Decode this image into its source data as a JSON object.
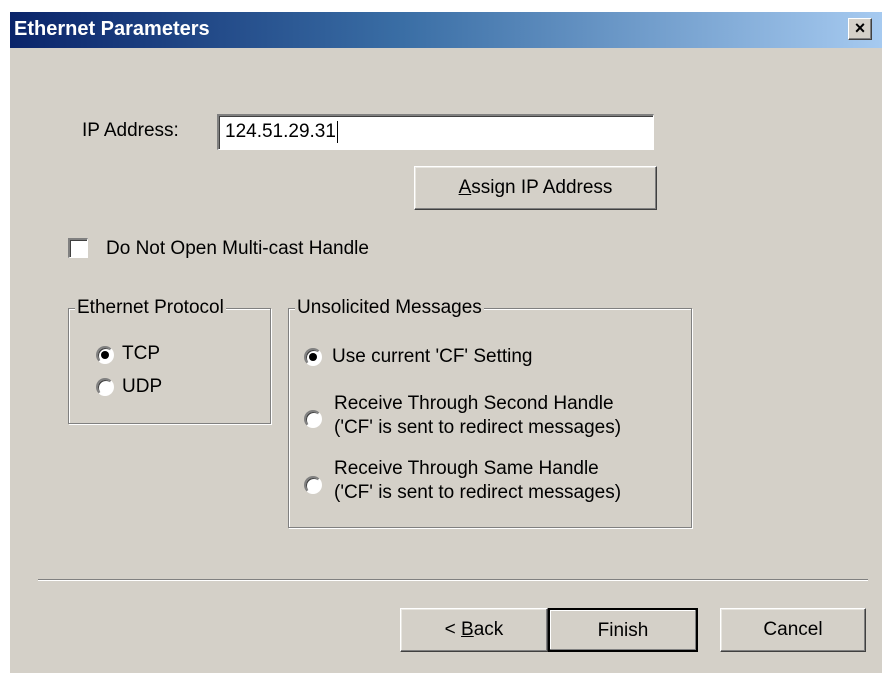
{
  "dialog": {
    "title": "Ethernet Parameters",
    "close_glyph": "×"
  },
  "ip": {
    "label": "IP Address:",
    "value": "124.51.29.31"
  },
  "assign_button": {
    "mnemonic": "A",
    "rest": "ssign IP Address"
  },
  "multicast_checkbox": {
    "label": "Do Not Open Multi-cast Handle",
    "checked": false
  },
  "protocol_group": {
    "legend": "Ethernet Protocol",
    "options": [
      {
        "label": "TCP",
        "selected": true
      },
      {
        "label": "UDP",
        "selected": false
      }
    ]
  },
  "unsolicited_group": {
    "legend": "Unsolicited Messages",
    "options": [
      {
        "label": "Use current 'CF' Setting",
        "sublabel": "",
        "selected": true
      },
      {
        "label": "Receive Through Second Handle",
        "sublabel": "('CF' is sent to redirect messages)",
        "selected": false
      },
      {
        "label": "Receive Through Same Handle",
        "sublabel": "('CF' is sent to redirect messages)",
        "selected": false
      }
    ]
  },
  "footer": {
    "back_prefix": "< ",
    "back_mnemonic": "B",
    "back_rest": "ack",
    "finish_label": "Finish",
    "cancel_label": "Cancel"
  },
  "colors": {
    "face": "#d4d0c8",
    "title_start": "#0a246a",
    "title_end": "#a6caf0"
  }
}
